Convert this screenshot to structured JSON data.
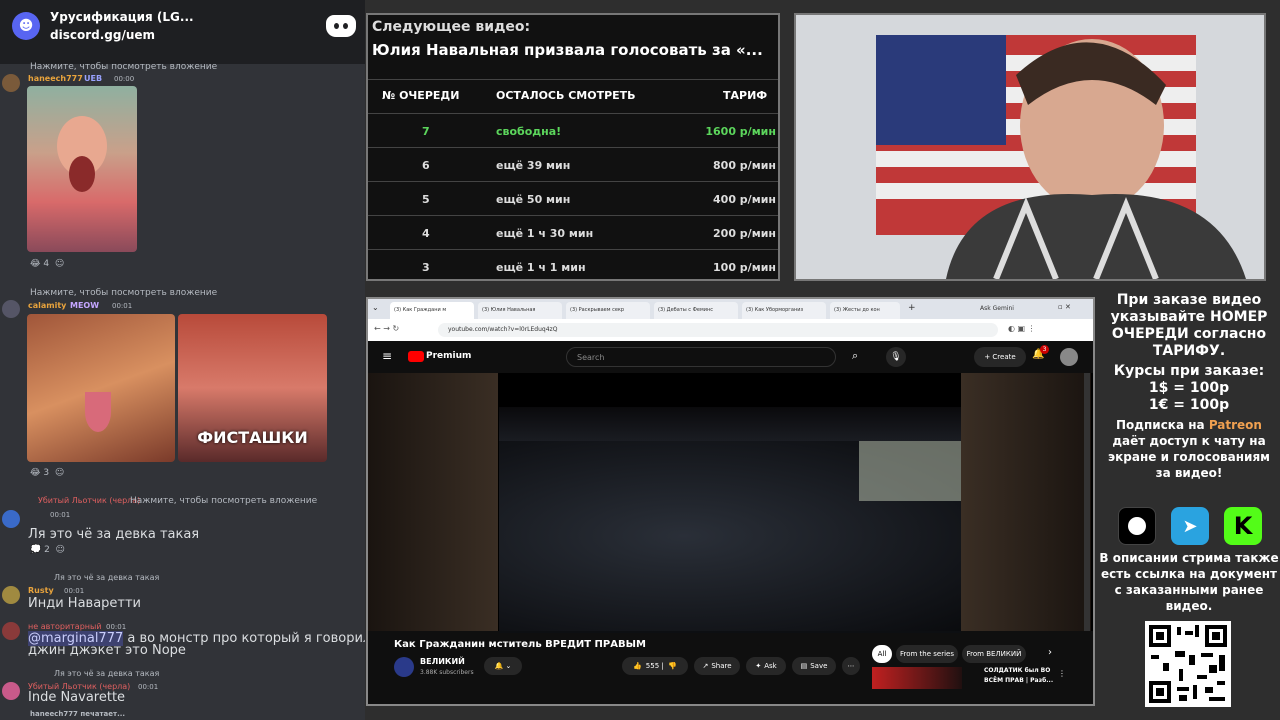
{
  "discord": {
    "server_title": "Урусификация (LG...",
    "invite": "discord.gg/uem",
    "messages": [
      {
        "user": "haneech777",
        "badge": "UEB",
        "time": "00:00",
        "top_line": "Нажмите, чтобы посмотреть вложение",
        "reaction_count": "4"
      },
      {
        "user": "calamity",
        "badge": "MEOW",
        "time": "00:01",
        "top_line": "Нажмите, чтобы посмотреть вложение",
        "reaction_count": "3",
        "image_caption": "ФИСТАШКИ"
      },
      {
        "user": "Убитый Льотчик (черла)",
        "time": "00:01",
        "top_line": "Нажмите, чтобы посмотреть вложение",
        "text": "Ля это чё за девка такая",
        "reaction_count": "2"
      },
      {
        "user": "Rusty",
        "time": "00:01",
        "reply": "Ля это чё за девка такая",
        "text": "Инди Наваретти"
      },
      {
        "user": "не авторитарный",
        "time": "00:01",
        "text_mention": "@marginal777",
        "text": "а во монстр про который я говорил",
        "text2": "джин джэкет это Nope"
      },
      {
        "user": "Убитый Льотчик (черла)",
        "time": "00:01",
        "reply": "Ля это чё за девка такая",
        "text": "Inde Navarette"
      }
    ],
    "typing": "haneech777 печатает..."
  },
  "queue": {
    "label": "Следующее видео:",
    "next_title": "Юлия Навальная призвала голосовать за «...",
    "headers": [
      "№ ОЧЕРЕДИ",
      "ОСТАЛОСЬ СМОТРЕТЬ",
      "ТАРИФ"
    ],
    "rows": [
      {
        "num": "7",
        "left": "свободна!",
        "rate": "1600 р/мин",
        "free": true
      },
      {
        "num": "6",
        "left": "ещё 39 мин",
        "rate": "800 р/мин"
      },
      {
        "num": "5",
        "left": "ещё 50 мин",
        "rate": "400 р/мин"
      },
      {
        "num": "4",
        "left": "ещё 1 ч 30 мин",
        "rate": "200 р/мин"
      },
      {
        "num": "3",
        "left": "ещё 1 ч 1 мин",
        "rate": "100 р/мин"
      }
    ]
  },
  "browser": {
    "tabs": [
      "(3) Как Граждани м",
      "(3) Юлия Навальная",
      "(3) Раскрываем секр",
      "(3) Дебаты с Феминс",
      "(3) Как Уборморганиз",
      "(3) Жесты до кон"
    ],
    "ask_gemini": "Ask Gemini",
    "url": "youtube.com/watch?v=l0rLEduq4zQ",
    "yt_brand": "Premium",
    "search_placeholder": "Search",
    "create": "Create",
    "notif_count": "3",
    "video_title": "Как Гражданин мститель ВРЕДИТ ПРАВЫМ",
    "channel": "ВЕЛИКИЙ",
    "subscribers": "3.88K subscribers",
    "likes": "555",
    "share": "Share",
    "ask": "Ask",
    "save": "Save",
    "chips": [
      "All",
      "From the series",
      "From ВЕЛИКИЙ"
    ],
    "rec_title_1": "СОЛДАТИК был ВО",
    "rec_title_2": "ВСЁМ ПРАВ | Разб..."
  },
  "info": {
    "line1": "При заказе видео",
    "line2": "указывайте НОМЕР",
    "line3": "ОЧЕРЕДИ согласно",
    "line4": "ТАРИФУ.",
    "line5": "Курсы при заказе:",
    "line6": "1$ = 100р",
    "line7": "1€ = 100р",
    "sub1": "Подписка на",
    "patreon": "Patreon",
    "sub2": "даёт доступ к чату на",
    "sub3": "экране и голосованиям",
    "sub4": "за видео!",
    "desc1": "В описании стрима также",
    "desc2": "есть ссылка на документ",
    "desc3": "с заказанными ранее",
    "desc4": "видео.",
    "colors": {
      "patreon": "#f0a050",
      "free": "#5cd65c"
    }
  }
}
